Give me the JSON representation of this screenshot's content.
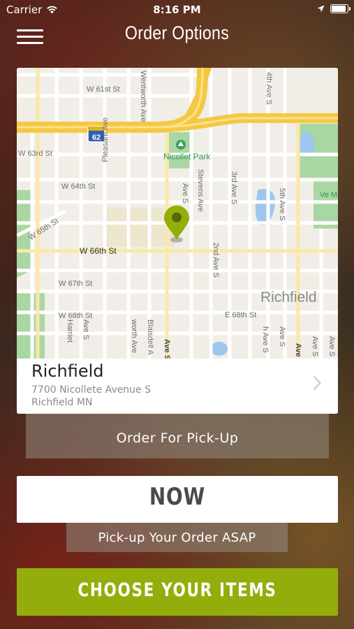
{
  "status_bar": {
    "carrier": "Carrier",
    "time": "8:16 PM"
  },
  "nav": {
    "title": "Order Options",
    "menu_icon": "hamburger-icon"
  },
  "map": {
    "labels": {
      "w61": "W 61st St",
      "wentworth_top": "Wentworth Ave",
      "ave4": "4th Ave S",
      "hwy": "62",
      "w63": "W 63rd St",
      "park": "Nicollet Park",
      "w64": "W 64th St",
      "pleasant": "Pleasant Ave",
      "ave_s_top": "Ave S",
      "stevens": "Stevens Ave",
      "ave3": "3rd Ave S",
      "ave5": "5th Ave S",
      "memorial": "Ve\nMem",
      "w65": "W 65th St",
      "w66": "W 66th St",
      "ave2": "2nd Ave S",
      "w67": "W 67th St",
      "richfield": "Richfield",
      "w68": "W 68th St",
      "e68": "E 68th St",
      "harriet": "Harriet",
      "ave_s_bottom_left": "Ave S",
      "wentworth_bottom": "worth Ave",
      "blaisdell": "Blaisdell A",
      "ave_s_bold": "Ave S",
      "h_ave_s": "h Ave S",
      "ave_s_right": "Ave S",
      "ave_bold": "Ave",
      "ave_s_far": "Ave S",
      "ave_s_far2": "Ave S"
    },
    "accent": "#93ae0a"
  },
  "location": {
    "name": "Richfield",
    "address_line1": "7700 Nicollete Avenue S",
    "address_line2": "Richfield MN"
  },
  "pickup_button": "Order For Pick-Up",
  "time_option": {
    "label": "NOW",
    "subtitle": "Pick-up Your Order ASAP"
  },
  "choose_button": "CHOOSE YOUR ITEMS"
}
